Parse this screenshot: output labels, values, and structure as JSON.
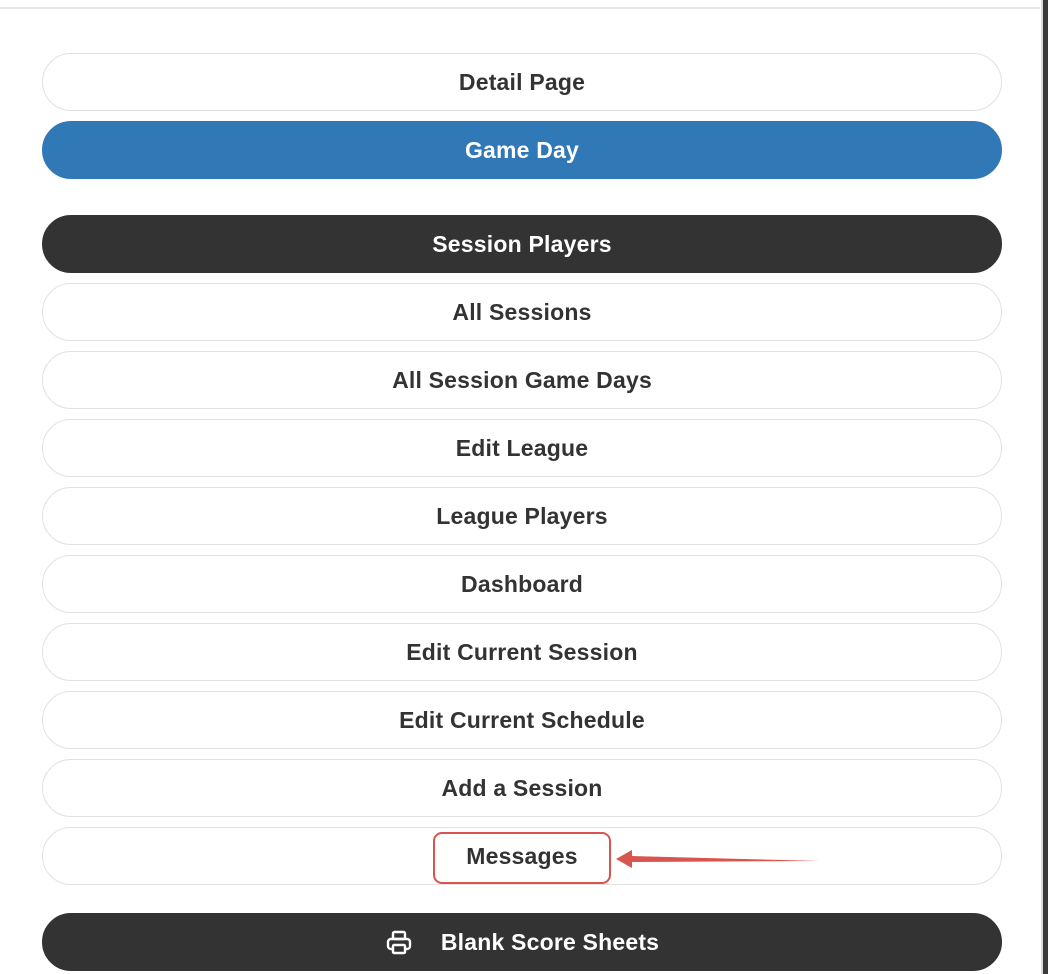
{
  "menu": {
    "detail_page": "Detail Page",
    "game_day": "Game Day",
    "session_players": "Session Players",
    "all_sessions": "All Sessions",
    "all_session_game_days": "All Session Game Days",
    "edit_league": "Edit League",
    "league_players": "League Players",
    "dashboard": "Dashboard",
    "edit_current_session": "Edit Current Session",
    "edit_current_schedule": "Edit Current Schedule",
    "add_a_session": "Add a Session",
    "messages": "Messages",
    "blank_score_sheets": "Blank Score Sheets"
  },
  "icons": {
    "print": "printer-icon",
    "annotation_arrow": "left-arrow-icon"
  },
  "colors": {
    "primary": "#3178b7",
    "dark": "#333333",
    "outline_border": "#e1e1e1",
    "annotation": "#d9534f"
  }
}
